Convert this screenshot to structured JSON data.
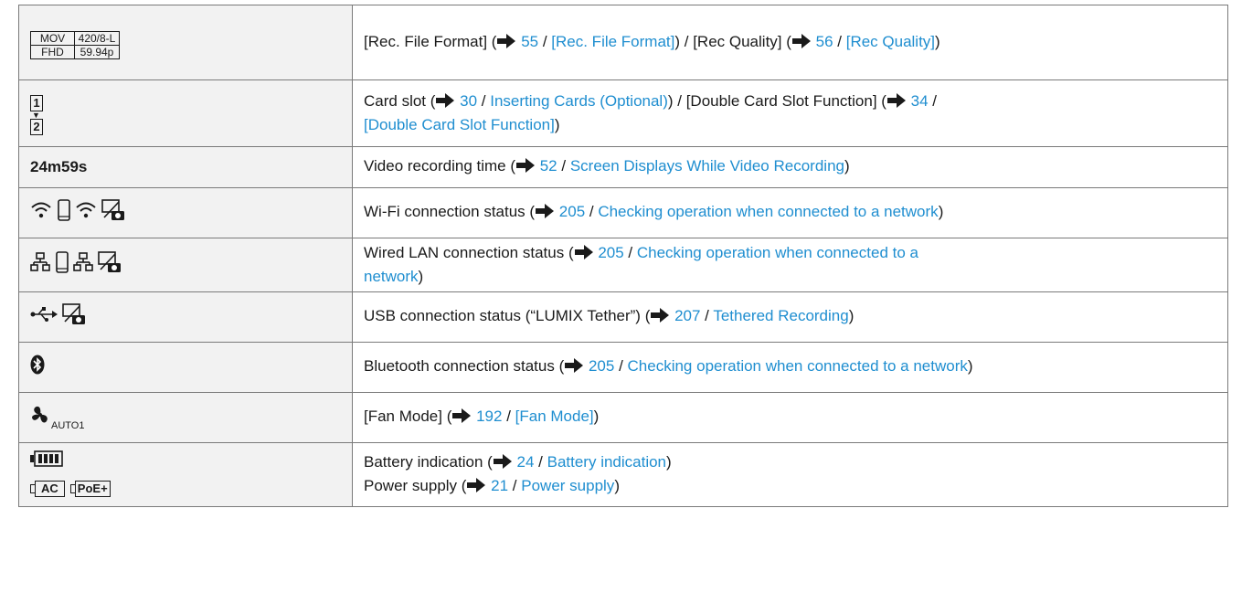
{
  "table": {
    "rows": [
      {
        "icon": {
          "name": "rec-format-quality",
          "cells": [
            "MOV",
            "420/8-L",
            "FHD",
            "59.94p"
          ]
        },
        "parts": [
          {
            "t": "text",
            "v": "[Rec. File Format] ("
          },
          {
            "t": "arrow"
          },
          {
            "t": "link",
            "v": " 55"
          },
          {
            "t": "text",
            "v": " / "
          },
          {
            "t": "link",
            "v": "[Rec. File Format]"
          },
          {
            "t": "text",
            "v": ") / [Rec Quality] ("
          },
          {
            "t": "arrow"
          },
          {
            "t": "link",
            "v": " 56"
          },
          {
            "t": "text",
            "v": " / "
          },
          {
            "t": "link",
            "v": "[Rec Quality]"
          },
          {
            "t": "text",
            "v": ")"
          }
        ]
      },
      {
        "icon": {
          "name": "card-slot",
          "cells": [
            "1",
            "2"
          ]
        },
        "parts": [
          {
            "t": "text",
            "v": "Card slot ("
          },
          {
            "t": "arrow"
          },
          {
            "t": "link",
            "v": " 30"
          },
          {
            "t": "text",
            "v": " / "
          },
          {
            "t": "link",
            "v": "Inserting Cards (Optional)"
          },
          {
            "t": "text",
            "v": ") / [Double Card Slot Function] ("
          },
          {
            "t": "arrow"
          },
          {
            "t": "link",
            "v": " 34"
          },
          {
            "t": "text",
            "v": " / "
          },
          {
            "t": "br"
          },
          {
            "t": "link",
            "v": "[Double Card Slot Function]"
          },
          {
            "t": "text",
            "v": ")"
          }
        ]
      },
      {
        "icon": {
          "name": "recording-time",
          "text": "24m59s"
        },
        "parts": [
          {
            "t": "text",
            "v": "Video recording time ("
          },
          {
            "t": "arrow"
          },
          {
            "t": "link",
            "v": " 52"
          },
          {
            "t": "text",
            "v": " / "
          },
          {
            "t": "link",
            "v": "Screen Displays While Video Recording"
          },
          {
            "t": "text",
            "v": ")"
          }
        ]
      },
      {
        "icon": {
          "name": "wifi-status"
        },
        "parts": [
          {
            "t": "text",
            "v": "Wi-Fi connection status ("
          },
          {
            "t": "arrow"
          },
          {
            "t": "link",
            "v": " 205"
          },
          {
            "t": "text",
            "v": " / "
          },
          {
            "t": "link",
            "v": "Checking operation when connected to a network"
          },
          {
            "t": "text",
            "v": ")"
          }
        ]
      },
      {
        "icon": {
          "name": "wired-lan-status"
        },
        "parts": [
          {
            "t": "text",
            "v": "Wired LAN connection status ("
          },
          {
            "t": "arrow"
          },
          {
            "t": "link",
            "v": " 205"
          },
          {
            "t": "text",
            "v": " / "
          },
          {
            "t": "link",
            "v": "Checking operation when connected to a"
          },
          {
            "t": "br"
          },
          {
            "t": "link",
            "v": "network"
          },
          {
            "t": "text",
            "v": ")"
          }
        ]
      },
      {
        "icon": {
          "name": "usb-status"
        },
        "parts": [
          {
            "t": "text",
            "v": "USB connection status (“LUMIX Tether”) ("
          },
          {
            "t": "arrow"
          },
          {
            "t": "link",
            "v": " 207"
          },
          {
            "t": "text",
            "v": " / "
          },
          {
            "t": "link",
            "v": "Tethered Recording"
          },
          {
            "t": "text",
            "v": ")"
          }
        ]
      },
      {
        "icon": {
          "name": "bluetooth-status"
        },
        "parts": [
          {
            "t": "text",
            "v": "Bluetooth connection status ("
          },
          {
            "t": "arrow"
          },
          {
            "t": "link",
            "v": " 205"
          },
          {
            "t": "text",
            "v": " / "
          },
          {
            "t": "link",
            "v": "Checking operation when connected to a network"
          },
          {
            "t": "text",
            "v": ")"
          }
        ]
      },
      {
        "icon": {
          "name": "fan-mode",
          "text": "AUTO1"
        },
        "parts": [
          {
            "t": "text",
            "v": "[Fan Mode] ("
          },
          {
            "t": "arrow"
          },
          {
            "t": "link",
            "v": " 192"
          },
          {
            "t": "text",
            "v": " / "
          },
          {
            "t": "link",
            "v": "[Fan Mode]"
          },
          {
            "t": "text",
            "v": ")"
          }
        ]
      },
      {
        "icon": {
          "name": "battery-power",
          "cells": [
            "AC",
            "PoE+"
          ]
        },
        "parts": [
          {
            "t": "text",
            "v": "Battery indication ("
          },
          {
            "t": "arrow"
          },
          {
            "t": "link",
            "v": " 24"
          },
          {
            "t": "text",
            "v": " / "
          },
          {
            "t": "link",
            "v": "Battery indication"
          },
          {
            "t": "text",
            "v": ")"
          },
          {
            "t": "br"
          },
          {
            "t": "text",
            "v": "Power supply ("
          },
          {
            "t": "arrow"
          },
          {
            "t": "link",
            "v": " 21"
          },
          {
            "t": "text",
            "v": " / "
          },
          {
            "t": "link",
            "v": "Power supply"
          },
          {
            "t": "text",
            "v": ")"
          }
        ]
      }
    ]
  },
  "colors": {
    "link": "#1f8ed0",
    "icon_cell_bg": "#f2f2f2",
    "border": "#7a7a7a"
  }
}
